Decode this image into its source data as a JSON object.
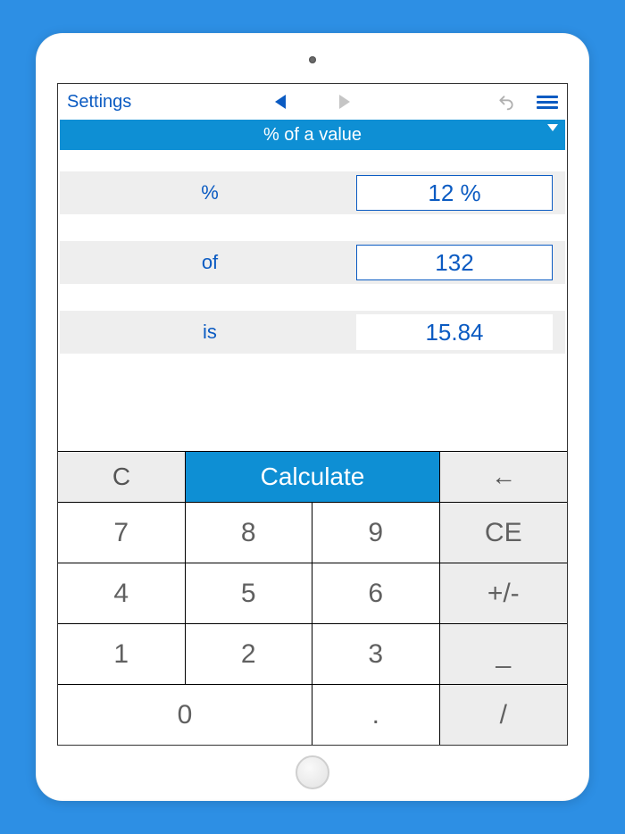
{
  "topbar": {
    "settings_label": "Settings"
  },
  "mode": {
    "label": "% of a value"
  },
  "rows": {
    "percent": {
      "label": "%",
      "value": "12 %"
    },
    "of": {
      "label": "of",
      "value": "132"
    },
    "is": {
      "label": "is",
      "value": "15.84"
    }
  },
  "actions": {
    "clear": "C",
    "calculate": "Calculate",
    "backspace": "←"
  },
  "keys": {
    "k7": "7",
    "k8": "8",
    "k9": "9",
    "ce": "CE",
    "k4": "4",
    "k5": "5",
    "k6": "6",
    "pm": "+/-",
    "k1": "1",
    "k2": "2",
    "k3": "3",
    "us": "_",
    "k0": "0",
    "dot": ".",
    "div": "/"
  }
}
